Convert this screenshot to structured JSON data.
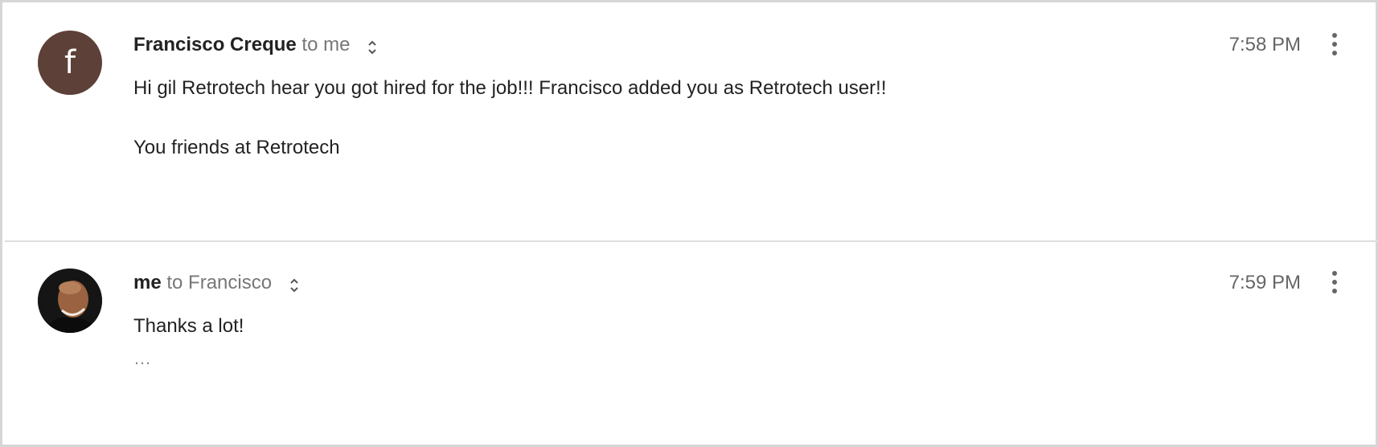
{
  "messages": [
    {
      "avatar": {
        "type": "letter",
        "letter": "f",
        "color": "#5d4037"
      },
      "sender": "Francisco Creque",
      "recipient": "to me",
      "time": "7:58 PM",
      "body": [
        "Hi gil Retrotech hear you got hired for the job!!! Francisco added you as Retrotech user!!",
        "You friends at Retrotech"
      ],
      "details_icon": "unfold-more-icon",
      "menu_icon": "more-vert-icon"
    },
    {
      "avatar": {
        "type": "photo"
      },
      "sender": "me",
      "recipient": "to Francisco",
      "time": "7:59 PM",
      "body": [
        "Thanks a lot!"
      ],
      "trimmed_content": "…",
      "details_icon": "unfold-more-icon",
      "menu_icon": "more-vert-icon"
    }
  ]
}
